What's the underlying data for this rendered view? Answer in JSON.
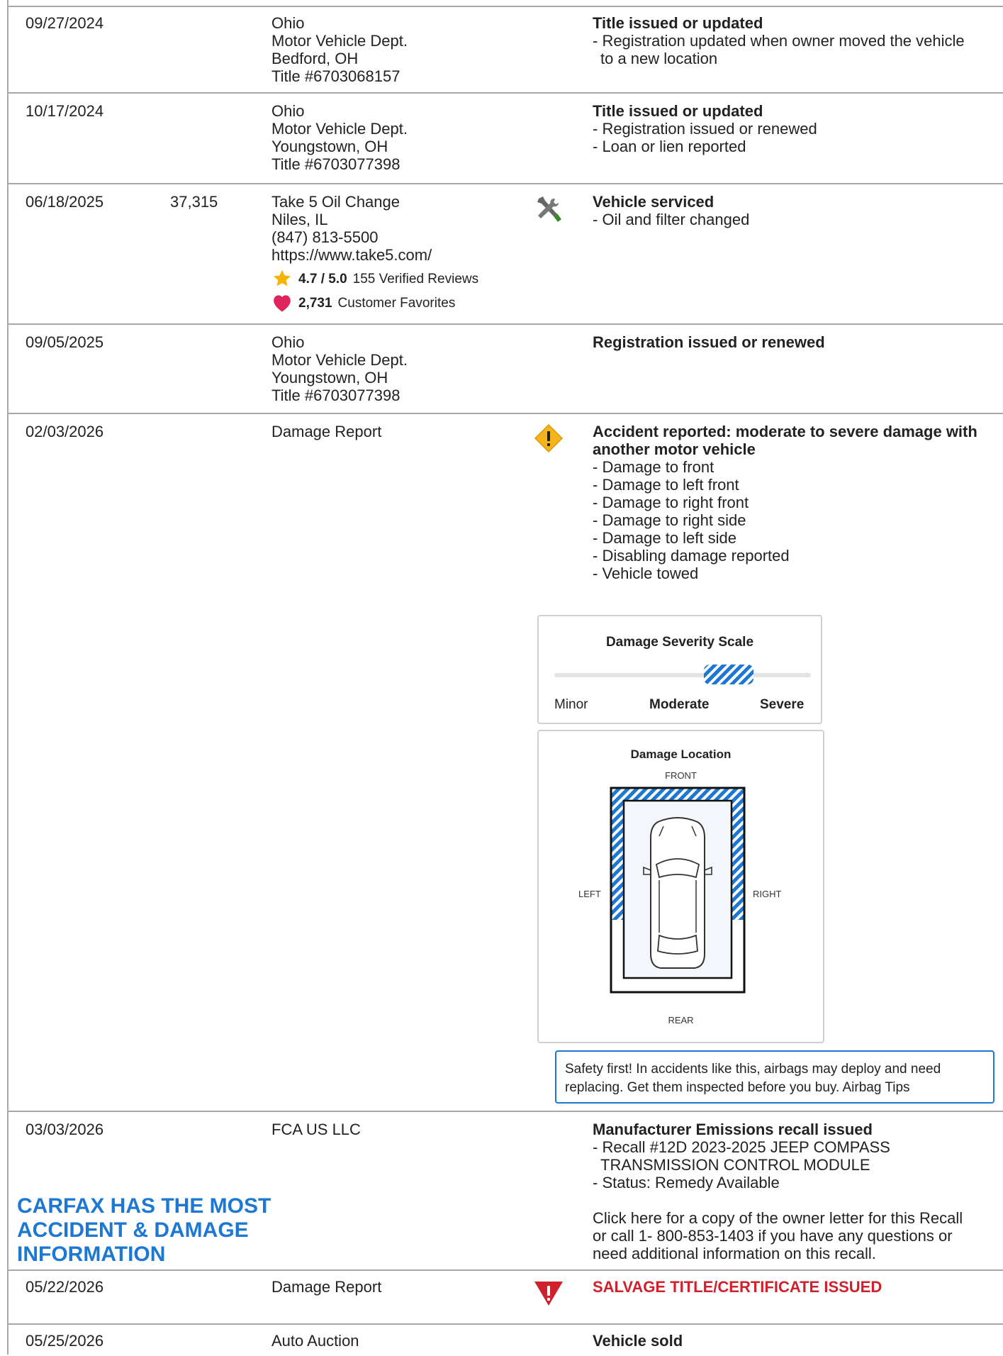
{
  "records": [
    {
      "date": "09/27/2024",
      "odometer": "",
      "source": [
        "Ohio",
        "Motor Vehicle Dept.",
        "Bedford, OH",
        "Title #6703068157"
      ],
      "comment_title": "Title issued or updated",
      "comments": [
        "- Registration updated when owner moved the vehicle",
        "to a new location"
      ]
    },
    {
      "date": "10/17/2024",
      "odometer": "",
      "source": [
        "Ohio",
        "Motor Vehicle Dept.",
        "Youngstown, OH",
        "Title #6703077398"
      ],
      "comment_title": "Title issued or updated",
      "comments": [
        "- Registration issued or renewed",
        "- Loan or lien reported"
      ]
    },
    {
      "date": "06/18/2025",
      "odometer": "37,315",
      "source": [
        "Take 5 Oil Change",
        "Niles, IL",
        "(847) 813-5500",
        "https://www.take5.com/"
      ],
      "rating_value": "4.7 / 5.0",
      "rating_reviews": "155 Verified Reviews",
      "favorites_count": "2,731",
      "favorites_label": "Customer Favorites",
      "icon": "wrench-screwdriver-icon",
      "comment_title": "Vehicle serviced",
      "comments": [
        "- Oil and filter changed"
      ]
    },
    {
      "date": "09/05/2025",
      "odometer": "",
      "source": [
        "Ohio",
        "Motor Vehicle Dept.",
        "Youngstown, OH",
        "Title #6703077398"
      ],
      "comment_title": "Registration issued or renewed",
      "comments": []
    },
    {
      "date": "02/03/2026",
      "odometer": "",
      "source": [
        "Damage Report"
      ],
      "icon": "warning-diamond-icon",
      "comment_title_lines": [
        "Accident reported: moderate to severe damage with",
        "another motor vehicle"
      ],
      "comments": [
        "- Damage to front",
        "- Damage to left front",
        "- Damage to right front",
        "- Damage to right side",
        "- Damage to left side",
        "- Disabling damage reported",
        "- Vehicle towed"
      ]
    },
    {
      "date": "03/03/2026",
      "odometer": "",
      "source": [
        "FCA US LLC"
      ],
      "comment_title": "Manufacturer Emissions recall issued",
      "comments": [
        "- Recall #12D 2023-2025 JEEP COMPASS",
        "TRANSMISSION CONTROL MODULE",
        "- Status: Remedy Available"
      ],
      "note_lines": [
        "Click here for a copy of the owner letter for this Recall",
        "or call 1- 800-853-1403 if you have any questions or",
        "need additional information on this recall."
      ]
    },
    {
      "date": "05/22/2026",
      "odometer": "",
      "source": [
        "Damage Report"
      ],
      "icon": "salvage-warning-icon",
      "comment_title": "SALVAGE TITLE/CERTIFICATE ISSUED"
    },
    {
      "date": "05/25/2026",
      "odometer": "",
      "source": [
        "Auto Auction"
      ],
      "comment_title": "Vehicle sold"
    }
  ],
  "promo_lines": [
    "CARFAX HAS THE MOST",
    "ACCIDENT & DAMAGE",
    "INFORMATION"
  ],
  "severity": {
    "title": "Damage Severity Scale",
    "labels": [
      "Minor",
      "Moderate",
      "Severe"
    ],
    "selected": "Moderate"
  },
  "location": {
    "title": "Damage Location",
    "front": "FRONT",
    "rear": "REAR",
    "left": "LEFT",
    "right": "RIGHT",
    "damaged_areas": [
      "front",
      "left-front",
      "right-front",
      "right-side",
      "left-side"
    ]
  },
  "tip_lines": [
    "Safety first! In accidents like this, airbags may deploy and need",
    "replacing. Get them inspected before you buy. Airbag Tips"
  ],
  "colors": {
    "accent": "#1c78d2",
    "alert_red": "#d0202c",
    "warning_yellow": "#f4b41a",
    "star": "#f5b400",
    "heart": "#e0245e",
    "border": "#a8a8a8"
  }
}
